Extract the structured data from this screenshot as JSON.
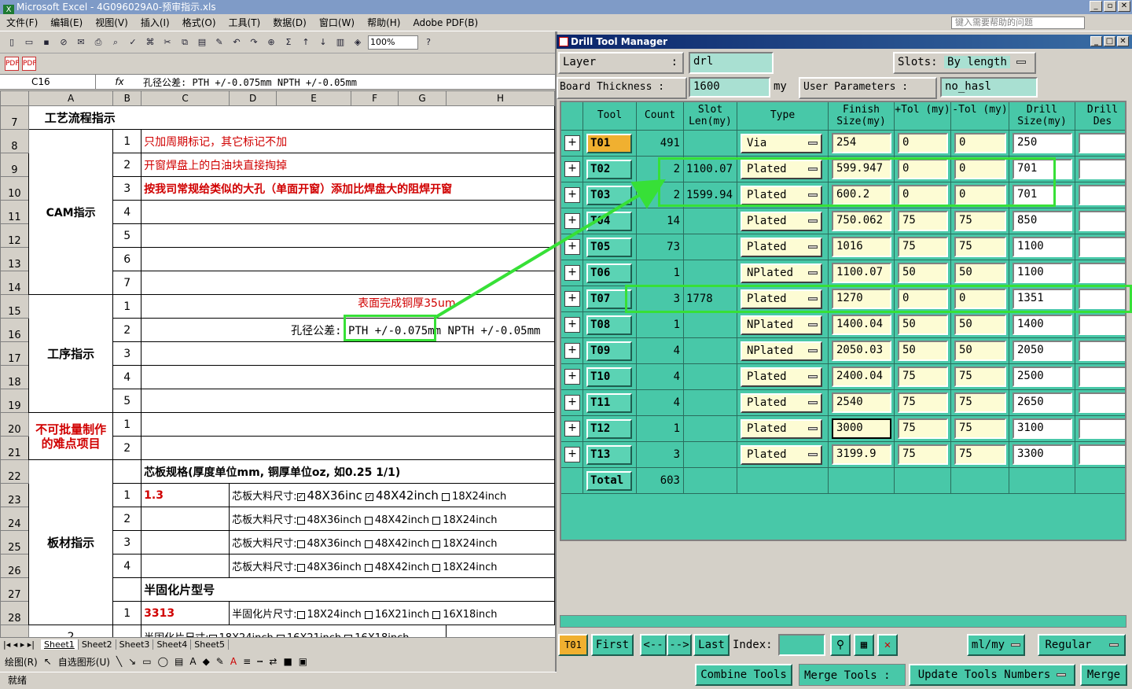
{
  "excel": {
    "title": "Microsoft Excel - 4G096029A0-预审指示.xls",
    "menu": [
      "文件(F)",
      "编辑(E)",
      "视图(V)",
      "插入(I)",
      "格式(O)",
      "工具(T)",
      "数据(D)",
      "窗口(W)",
      "帮助(H)",
      "Adobe PDF(B)"
    ],
    "help_placeholder": "键入需要帮助的问题",
    "zoom": "100%",
    "name_box": "C16",
    "fx": "fx",
    "formula": "孔径公差:  PTH +/-0.075mm NPTH +/-0.05mm",
    "col_headers": [
      "A",
      "B",
      "C",
      "D",
      "E",
      "F",
      "G",
      "H"
    ],
    "r7": "工艺流程指示",
    "cam_label": "CAM指示",
    "cam_items": [
      "只加周期标记，其它标记不加",
      "开窗焊盘上的白油块直接掏掉",
      "按我司常规给类似的大孔（单面开窗）添加比焊盘大的阻焊开窗"
    ],
    "process_label": "工序指示",
    "copper_note": "表面完成铜厚35um",
    "tolerance_label": "孔径公差:",
    "tolerance_pth": "PTH +/-0.075mm",
    "tolerance_npth": "NPTH +/-0.05mm",
    "difficult_label": "不可批量制作的难点项目",
    "core_spec": "芯板规格(厚度单位mm, 铜厚单位oz, 如0.25 1/1)",
    "core_value": "1.3",
    "core_size_label": "芯板大料尺寸:",
    "size_48x36": "48X36inch",
    "size_48x42": "48X42inch",
    "size_18x24": "18X24inch",
    "size_48x36_big": "48X36inc",
    "size_48x42_big": "48X42inch",
    "material_label": "板材指示",
    "prepreg_label": "半固化片型号",
    "prepreg_value": "3313",
    "prepreg_size_label": "半固化片尺寸:",
    "pp_18x24": "18X24inch",
    "pp_16x21": "16X21inch",
    "pp_16x18": "16X18inch",
    "sheets": [
      "Sheet1",
      "Sheet2",
      "Sheet3",
      "Sheet4",
      "Sheet5"
    ],
    "draw_label": "绘图(R)",
    "autoshape_label": "自选图形(U)",
    "status": "就绪"
  },
  "dtm": {
    "title": "Drill Tool Manager",
    "layer_label": "Layer",
    "layer_value": "drl",
    "slots_label": "Slots:",
    "slots_value": "By length",
    "thickness_label": "Board Thickness :",
    "thickness_value": "1600",
    "thickness_unit": "my",
    "user_params_label": "User Parameters :",
    "user_params_value": "no_hasl",
    "headers": [
      "Tool",
      "Count",
      "Slot Len(my)",
      "Type",
      "Finish Size(my)",
      "+Tol (my)",
      "-Tol (my)",
      "Drill Size(my)",
      "Drill Des"
    ],
    "rows": [
      {
        "tool": "T01",
        "count": "491",
        "slot": "",
        "type": "Via",
        "finish": "254",
        "ptol": "0",
        "ntol": "0",
        "drill": "250"
      },
      {
        "tool": "T02",
        "count": "2",
        "slot": "1100.07",
        "type": "Plated",
        "finish": "599.947",
        "ptol": "0",
        "ntol": "0",
        "drill": "701"
      },
      {
        "tool": "T03",
        "count": "2",
        "slot": "1599.94",
        "type": "Plated",
        "finish": "600.2",
        "ptol": "0",
        "ntol": "0",
        "drill": "701"
      },
      {
        "tool": "T04",
        "count": "14",
        "slot": "",
        "type": "Plated",
        "finish": "750.062",
        "ptol": "75",
        "ntol": "75",
        "drill": "850"
      },
      {
        "tool": "T05",
        "count": "73",
        "slot": "",
        "type": "Plated",
        "finish": "1016",
        "ptol": "75",
        "ntol": "75",
        "drill": "1100"
      },
      {
        "tool": "T06",
        "count": "1",
        "slot": "",
        "type": "NPlated",
        "finish": "1100.07",
        "ptol": "50",
        "ntol": "50",
        "drill": "1100"
      },
      {
        "tool": "T07",
        "count": "3",
        "slot": "1778",
        "type": "Plated",
        "finish": "1270",
        "ptol": "0",
        "ntol": "0",
        "drill": "1351"
      },
      {
        "tool": "T08",
        "count": "1",
        "slot": "",
        "type": "NPlated",
        "finish": "1400.04",
        "ptol": "50",
        "ntol": "50",
        "drill": "1400"
      },
      {
        "tool": "T09",
        "count": "4",
        "slot": "",
        "type": "NPlated",
        "finish": "2050.03",
        "ptol": "50",
        "ntol": "50",
        "drill": "2050"
      },
      {
        "tool": "T10",
        "count": "4",
        "slot": "",
        "type": "Plated",
        "finish": "2400.04",
        "ptol": "75",
        "ntol": "75",
        "drill": "2500"
      },
      {
        "tool": "T11",
        "count": "4",
        "slot": "",
        "type": "Plated",
        "finish": "2540",
        "ptol": "75",
        "ntol": "75",
        "drill": "2650"
      },
      {
        "tool": "T12",
        "count": "1",
        "slot": "",
        "type": "Plated",
        "finish": "3000",
        "ptol": "75",
        "ntol": "75",
        "drill": "3100"
      },
      {
        "tool": "T13",
        "count": "3",
        "slot": "",
        "type": "Plated",
        "finish": "3199.9",
        "ptol": "75",
        "ntol": "75",
        "drill": "3300"
      }
    ],
    "total_label": "Total",
    "total_count": "603",
    "current_tool": "T01",
    "first": "First",
    "prev": "<--",
    "next": "-->",
    "last": "Last",
    "index_label": "Index:",
    "unit_value": "ml/my",
    "mode_value": "Regular",
    "combine": "Combine Tools",
    "merge_label": "Merge Tools :",
    "update": "Update Tools Numbers",
    "merge": "Merge",
    "accent": "#48c8a8",
    "highlight": "#37e037"
  }
}
